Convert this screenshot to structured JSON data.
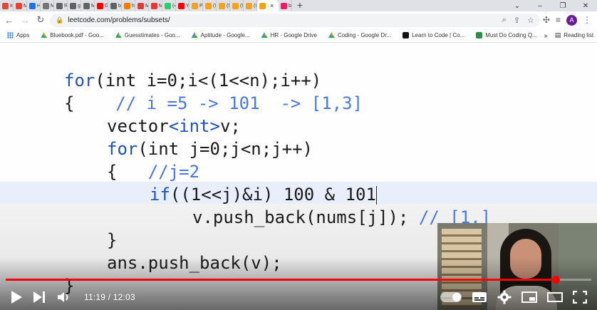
{
  "browser": {
    "tabs": [
      {
        "label": "In",
        "color": "#ea4335"
      },
      {
        "label": "M",
        "color": "#ea4335"
      },
      {
        "label": "H",
        "color": "#1a73e8"
      },
      {
        "label": "M",
        "color": "#757575"
      },
      {
        "label": "Ri",
        "color": "#5f6368"
      },
      {
        "label": "gr",
        "color": "#5f6368"
      },
      {
        "label": "M",
        "color": "#5f6368"
      },
      {
        "label": "G",
        "color": "#ff0000"
      },
      {
        "label": "bi",
        "color": "#5f6368"
      },
      {
        "label": "ht",
        "color": "#f57c00"
      },
      {
        "label": "M",
        "color": "#e53935"
      },
      {
        "label": "M",
        "color": "#e53935"
      },
      {
        "label": "(4",
        "color": "#25d366"
      },
      {
        "label": "Yc",
        "color": "#ff0000"
      },
      {
        "label": "Pr",
        "color": "#ffa116"
      },
      {
        "label": "(9",
        "color": "#ffa116"
      },
      {
        "label": "(9",
        "color": "#ffa116"
      },
      {
        "label": "(9",
        "color": "#ffa116"
      },
      {
        "label": "(9",
        "color": "#ffa116"
      }
    ],
    "active_tab": {
      "label": "",
      "close": "×",
      "color": "#ffa116"
    },
    "after_tab": {
      "label": "bl",
      "color": "#e91e63"
    },
    "new_tab": "+",
    "window_controls": [
      "⌄",
      "–",
      "❐",
      "✕"
    ],
    "url": "leetcode.com/problems/subsets/",
    "avatar_letter": "A",
    "bookmarks": [
      {
        "label": "Apps",
        "icon": "apps-grid-icon",
        "color": "#1a73e8"
      },
      {
        "label": "Bluebook.pdf - Goo...",
        "icon": "drive-icon",
        "color": "#34a853"
      },
      {
        "label": "Guesstimates - Goo...",
        "icon": "drive-icon",
        "color": "#34a853"
      },
      {
        "label": "Aptitude - Google...",
        "icon": "drive-icon",
        "color": "#34a853"
      },
      {
        "label": "HR - Google Drive",
        "icon": "drive-icon",
        "color": "#34a853"
      },
      {
        "label": "Coding - Google Dr...",
        "icon": "drive-icon",
        "color": "#34a853"
      },
      {
        "label": "Learn to Code | Co...",
        "icon": "code-icon",
        "color": "#111111"
      },
      {
        "label": "Must Do Coding Q...",
        "icon": "gfg-icon",
        "color": "#2f8d46"
      }
    ],
    "bookmarks_more": "»",
    "reading_list": "Reading list"
  },
  "video": {
    "code_lines": [
      [
        {
          "t": "for",
          "c": "kw"
        },
        {
          "t": "(int i=0;i<(1<<n);i++)",
          "c": ""
        }
      ],
      [
        {
          "t": "{    ",
          "c": ""
        },
        {
          "t": "// i =5 -> 101  -> [1,3]",
          "c": "cm"
        }
      ],
      [
        {
          "t": "vector",
          "c": ""
        },
        {
          "t": "<int>",
          "c": "kw"
        },
        {
          "t": "v;",
          "c": ""
        }
      ],
      [
        {
          "t": "for",
          "c": "kw"
        },
        {
          "t": "(int j=0;j<n;j++)",
          "c": ""
        }
      ],
      [
        {
          "t": "{   ",
          "c": ""
        },
        {
          "t": "//j=2",
          "c": "cm"
        }
      ],
      [
        {
          "t": "if",
          "c": "kw"
        },
        {
          "t": "((1<<j)&i) 100 & 101",
          "c": ""
        }
      ],
      [
        {
          "t": "v.push_back(nums[j]); ",
          "c": ""
        },
        {
          "t": "// [1,]",
          "c": "cm"
        }
      ],
      [
        {
          "t": "}",
          "c": ""
        }
      ],
      [
        {
          "t": "ans.push_back(v);",
          "c": ""
        }
      ],
      [
        {
          "t": "}",
          "c": ""
        }
      ]
    ],
    "player": {
      "current_time": "11:19",
      "separator": " / ",
      "duration": "12:03",
      "progress": 0.939,
      "accent": "#ff0000"
    }
  }
}
